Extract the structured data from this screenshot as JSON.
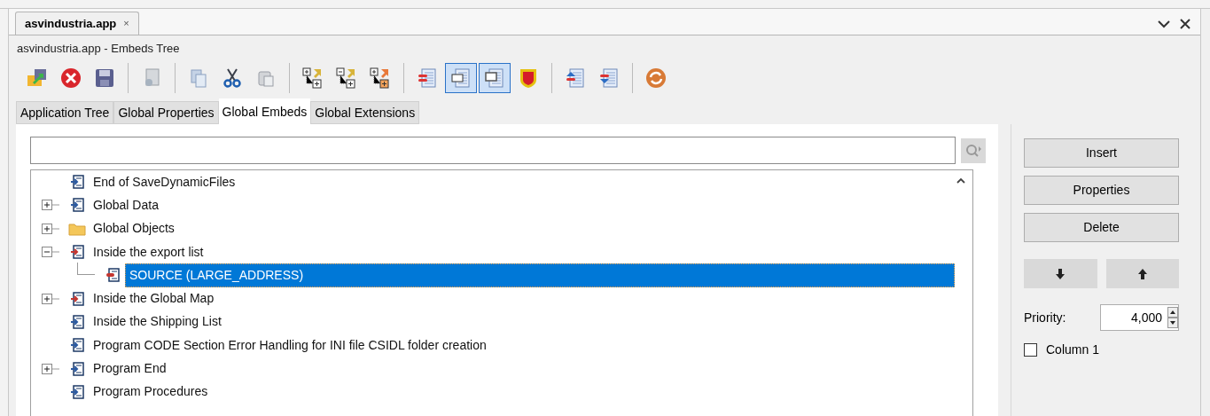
{
  "document_tab": {
    "label": "asvindustria.app",
    "close": "×",
    "selected": true
  },
  "window": {
    "title": "asvindustria.app - Embeds Tree"
  },
  "toolbar": [
    {
      "kind": "open",
      "pressed": false
    },
    {
      "kind": "cancel",
      "pressed": false
    },
    {
      "kind": "save",
      "pressed": false
    },
    {
      "kind": "sep"
    },
    {
      "kind": "preview",
      "pressed": false
    },
    {
      "kind": "sep"
    },
    {
      "kind": "copy",
      "pressed": false
    },
    {
      "kind": "cut",
      "pressed": false
    },
    {
      "kind": "paste",
      "pressed": false
    },
    {
      "kind": "sep"
    },
    {
      "kind": "expand",
      "pressed": false
    },
    {
      "kind": "collapse",
      "pressed": false
    },
    {
      "kind": "expand_orange",
      "pressed": false
    },
    {
      "kind": "sep"
    },
    {
      "kind": "list_red",
      "pressed": false
    },
    {
      "kind": "list_view",
      "pressed": true
    },
    {
      "kind": "list_dark",
      "pressed": true
    },
    {
      "kind": "shield",
      "pressed": false
    },
    {
      "kind": "sep"
    },
    {
      "kind": "move_up",
      "pressed": false
    },
    {
      "kind": "move_down",
      "pressed": false
    },
    {
      "kind": "sep"
    },
    {
      "kind": "refresh",
      "pressed": false
    }
  ],
  "tabs": [
    {
      "label": "Application Tree",
      "selected": false
    },
    {
      "label": "Global Properties",
      "selected": false
    },
    {
      "label": "Global Embeds",
      "selected": true
    },
    {
      "label": "Global Extensions",
      "selected": false
    }
  ],
  "tree": [
    {
      "label": "End of SaveDynamicFiles",
      "kind": "embed",
      "selected": false
    },
    {
      "label": "Global Data",
      "kind": "embed",
      "expanded": false,
      "selected": false
    },
    {
      "label": "Global Objects",
      "kind": "folder",
      "expanded": false,
      "selected": false
    },
    {
      "label": "Inside the export list",
      "kind": "embed_red",
      "expanded": true,
      "selected": false,
      "children": [
        {
          "label": "SOURCE (LARGE_ADDRESS)",
          "kind": "source",
          "selected": true
        }
      ]
    },
    {
      "label": "Inside the Global Map",
      "kind": "embed_red",
      "expanded": false,
      "selected": false
    },
    {
      "label": "Inside the Shipping List",
      "kind": "embed",
      "selected": false
    },
    {
      "label": "Program CODE Section Error Handling for INI file CSIDL folder creation",
      "kind": "embed",
      "selected": false
    },
    {
      "label": "Program End",
      "kind": "embed",
      "expanded": false,
      "selected": false
    },
    {
      "label": "Program Procedures",
      "kind": "embed",
      "selected": false
    }
  ],
  "buttons": [
    "Insert",
    "Properties",
    "Delete"
  ],
  "priority": {
    "label": "Priority:",
    "value": "4,000"
  },
  "column_checkbox": {
    "label": "Column 1",
    "checked": false
  }
}
